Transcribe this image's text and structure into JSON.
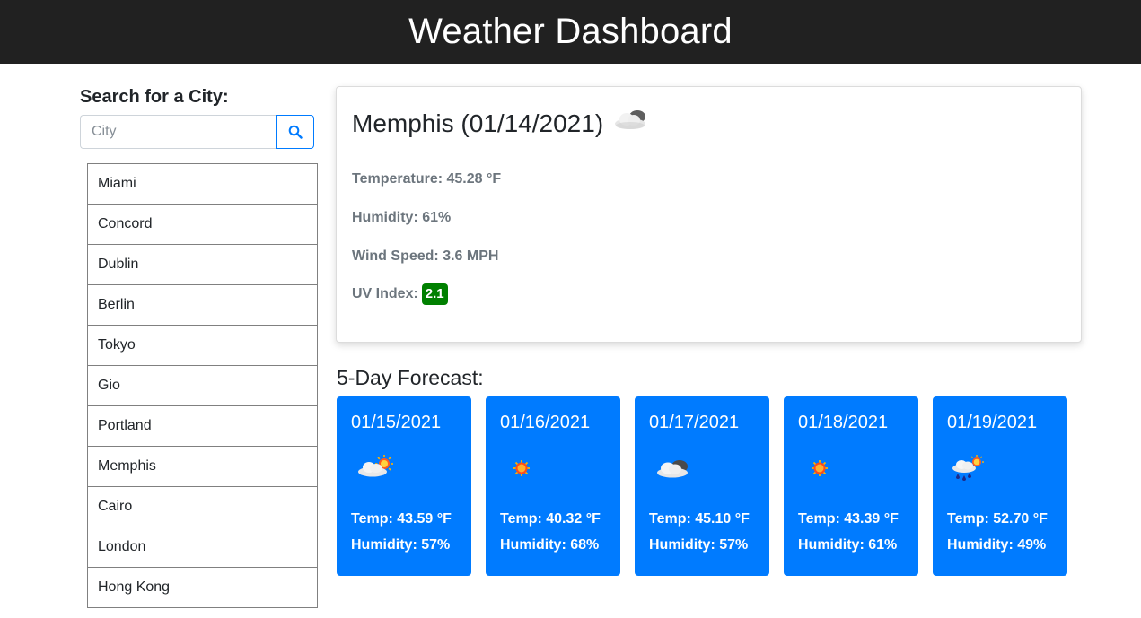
{
  "header": {
    "title": "Weather Dashboard"
  },
  "search": {
    "label": "Search for a City:",
    "placeholder": "City",
    "value": ""
  },
  "cities": [
    "Miami",
    "Concord",
    "Dublin",
    "Berlin",
    "Tokyo",
    "Gio",
    "Portland",
    "Memphis",
    "Cairo",
    "London",
    "Hong Kong"
  ],
  "current": {
    "title": "Memphis (01/14/2021)",
    "icon": "cloudy-icon",
    "temperature": "Temperature: 45.28 °F",
    "humidity": "Humidity: 61%",
    "wind": "Wind Speed: 3.6 MPH",
    "uv_label": "UV Index:",
    "uv_value": "2.1",
    "uv_color": "#008000"
  },
  "forecast": {
    "label": "5-Day Forecast:",
    "days": [
      {
        "date": "01/15/2021",
        "icon": "partly-cloudy-icon",
        "temp": "Temp: 43.59 °F",
        "humidity": "Humidity: 57%"
      },
      {
        "date": "01/16/2021",
        "icon": "sun-icon",
        "temp": "Temp: 40.32 °F",
        "humidity": "Humidity: 68%"
      },
      {
        "date": "01/17/2021",
        "icon": "cloudy-icon",
        "temp": "Temp: 45.10 °F",
        "humidity": "Humidity: 57%"
      },
      {
        "date": "01/18/2021",
        "icon": "sun-icon",
        "temp": "Temp: 43.39 °F",
        "humidity": "Humidity: 61%"
      },
      {
        "date": "01/19/2021",
        "icon": "rain-sun-icon",
        "temp": "Temp: 52.70 °F",
        "humidity": "Humidity: 49%"
      }
    ]
  },
  "colors": {
    "header_bg": "#212121",
    "accent": "#007bff",
    "uv_badge": "#008000"
  }
}
